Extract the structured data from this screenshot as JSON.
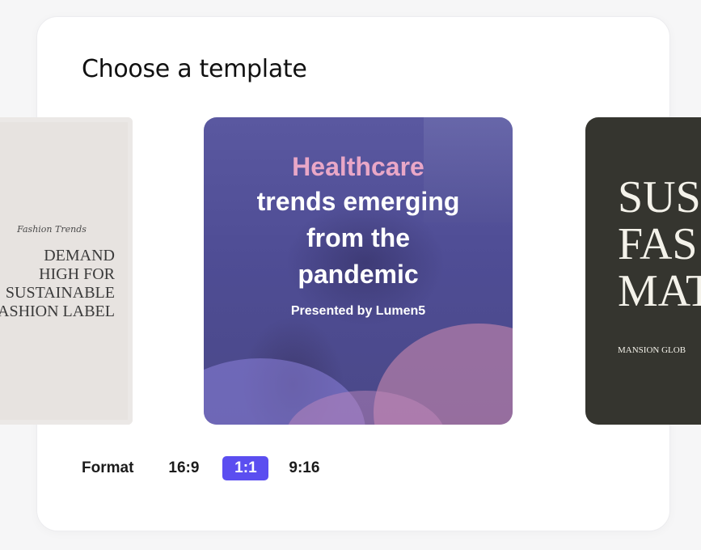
{
  "header": {
    "title": "Choose a template"
  },
  "templates": [
    {
      "script_text": "Fashion Trends",
      "headline_lines": [
        "DEMAND",
        "HIGH FOR",
        "SUSTAINABLE",
        "FASHION LABEL"
      ]
    },
    {
      "kicker": "Healthcare",
      "lines": [
        "trends emerging",
        "from the",
        "pandemic"
      ],
      "byline": "Presented by Lumen5"
    },
    {
      "headline_lines": [
        "SUS",
        "FAS",
        "MAT"
      ],
      "subtext": "MANSION GLOB"
    }
  ],
  "format": {
    "label": "Format",
    "options": [
      "16:9",
      "1:1",
      "9:16"
    ],
    "selected": "1:1"
  },
  "colors": {
    "accent": "#5b4ef0",
    "healthcare_kicker": "#e9a7c7",
    "dark_template_bg": "#35352f",
    "light_template_bg": "#e7e3e0"
  }
}
